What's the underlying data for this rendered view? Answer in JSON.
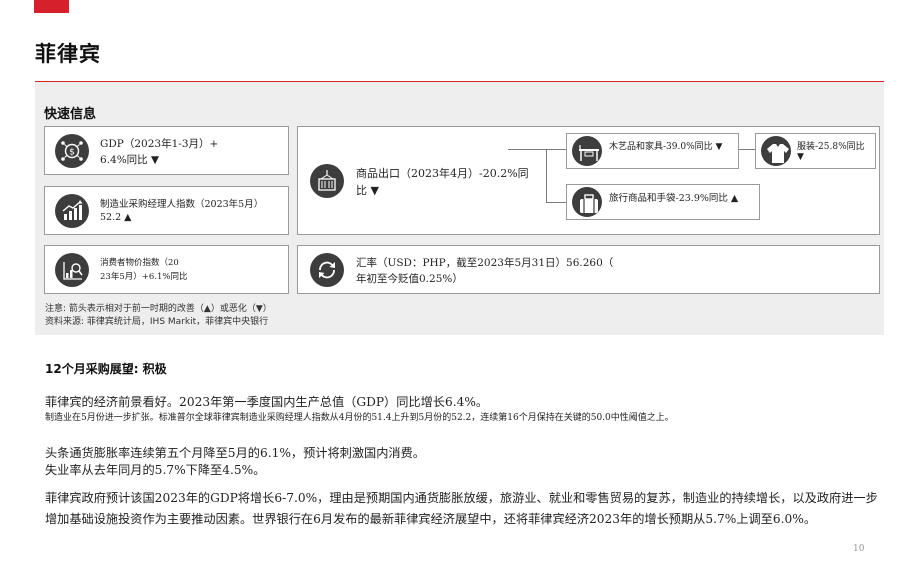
{
  "page": {
    "title": "菲律宾",
    "number": "10"
  },
  "quick_info": {
    "heading": "快速信息",
    "gdp": {
      "line1": "GDP（2023年1-3月）+",
      "line2": "6.4%同比 ▼",
      "icon": "dollar-network-icon"
    },
    "pmi": {
      "line1": "制造业采购经理人指数（2023年5月）",
      "line2": "52.2 ▲",
      "icon": "bar-chart-arrow-icon"
    },
    "cpi": {
      "line1": "消费者物价指数（20",
      "line2": "23年5月）+6.1%同比",
      "icon": "magnifier-chart-icon"
    },
    "exports": {
      "line1": "商品出口（2023年4月）-20.2%同",
      "line2": "比 ▼",
      "icon": "shipping-container-icon"
    },
    "furniture": {
      "text": "木艺品和家具-39.0%同比 ▼",
      "icon": "furniture-icon"
    },
    "apparel": {
      "line1": "服装-25.8%同比",
      "line2": "▼",
      "icon": "tshirt-icon"
    },
    "travel_goods": {
      "text": "旅行商品和手袋-23.9%同比 ▲",
      "icon": "suitcase-icon"
    },
    "fx": {
      "line1": "汇率（USD：PHP，截至2023年5月31日）56.260（",
      "line2": "年初至今贬值0.25%）",
      "icon": "refresh-arrows-icon"
    },
    "note_line1": "注意: 箭头表示相对于前一时期的改善（▲）或恶化（▼）",
    "note_line2": "资料来源: 菲律宾统计局，IHS Markit，菲律宾中央银行"
  },
  "outlook": {
    "heading": "12个月采购展望: 积极",
    "p1": "菲律宾的经济前景看好。2023年第一季度国内生产总值（GDP）同比增长6.4%。",
    "p2": "制造业在5月份进一步扩张。标准普尔全球菲律宾制造业采购经理人指数从4月份的51.4上升到5月份的52.2，连续第16个月保持在关键的50.0中性阈值之上。",
    "p3": "头条通货膨胀率连续第五个月降至5月的6.1%，预计将刺激国内消费。",
    "p4": "失业率从去年同月的5.7%下降至4.5%。",
    "p5": "菲律宾政府预计该国2023年的GDP将增长6-7.0%，理由是预期国内通货膨胀放缓，旅游业、就业和零售贸易的复苏，制造业的持续增长，以及政府进一步增加基础设施投资作为主要推动因素。世界银行在6月发布的最新菲律宾经济展望中，还将菲律宾经济2023年的增长预期从5.7%上调至6.0%。"
  },
  "colors": {
    "accent": "#d6212c",
    "panel": "#eeeeee",
    "icon_bg": "#3d3d3d"
  }
}
